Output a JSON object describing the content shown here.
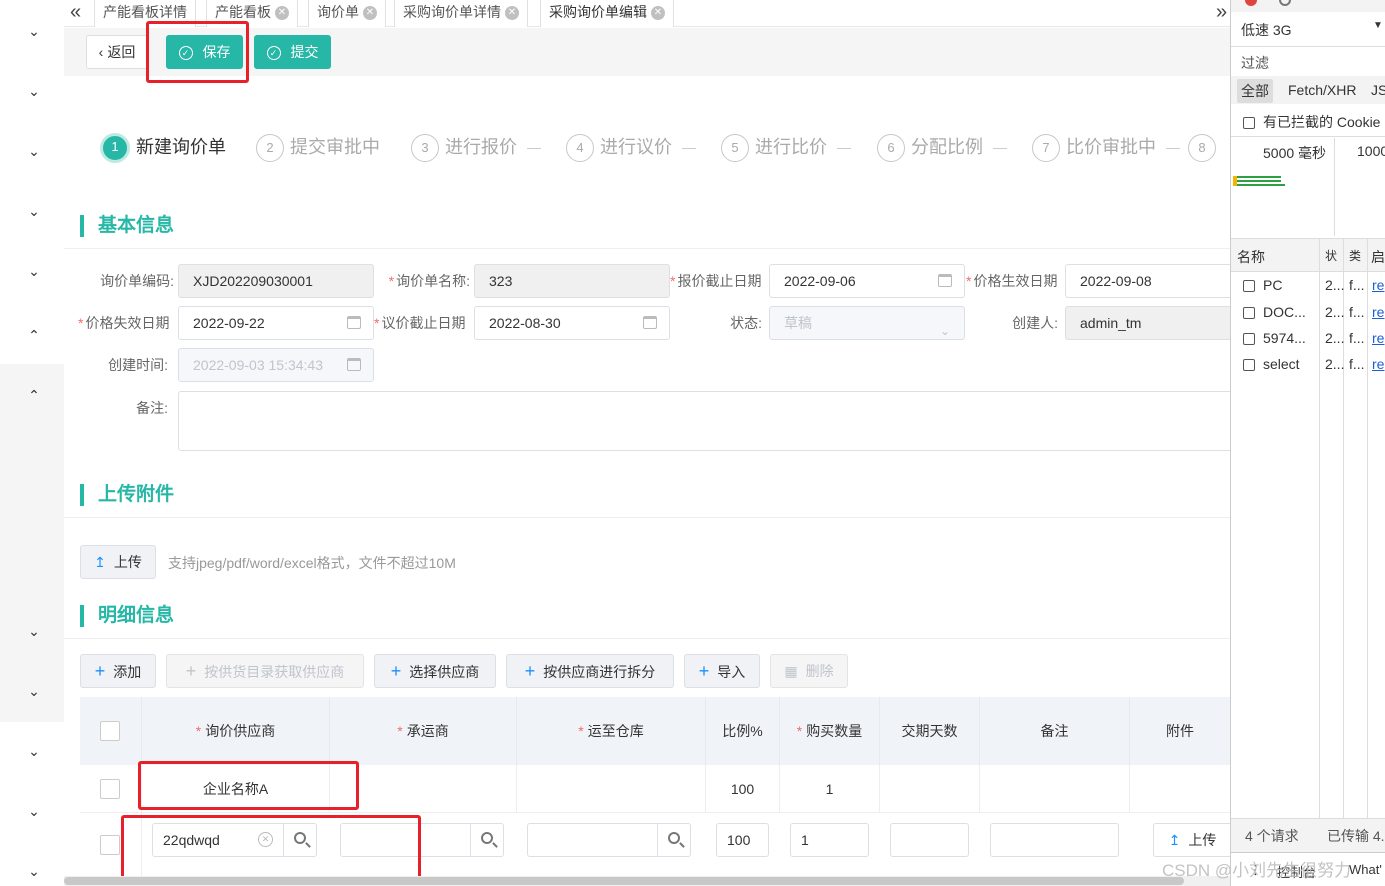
{
  "tabs": {
    "collapse_icon": "double-chevron-left",
    "items": [
      {
        "label": "产能看板详情",
        "closable": false
      },
      {
        "label": "产能看板",
        "closable": true
      },
      {
        "label": "询价单",
        "closable": true
      },
      {
        "label": "采购询价单详情",
        "closable": true
      },
      {
        "label": "采购询价单编辑",
        "closable": true
      }
    ],
    "expand_icon": "double-chevron-right"
  },
  "toolbar": {
    "back_label": "返回",
    "save_label": "保存",
    "submit_label": "提交"
  },
  "steps": [
    {
      "num": "1",
      "label": "新建询价单",
      "active": true
    },
    {
      "num": "2",
      "label": "提交审批中"
    },
    {
      "num": "3",
      "label": "进行报价"
    },
    {
      "num": "4",
      "label": "进行议价"
    },
    {
      "num": "5",
      "label": "进行比价"
    },
    {
      "num": "6",
      "label": "分配比例"
    },
    {
      "num": "7",
      "label": "比价审批中"
    },
    {
      "num": "8",
      "label": ""
    }
  ],
  "basic": {
    "title": "基本信息",
    "code_label": "询价单编码:",
    "code_value": "XJD202209030001",
    "name_label": "询价单名称:",
    "name_value": "323",
    "quote_deadline_label": "报价截止日期",
    "quote_deadline_value": "2022-09-06",
    "price_start_label": "价格生效日期",
    "price_start_value": "2022-09-08",
    "price_end_label": "价格失效日期",
    "price_end_value": "2022-09-22",
    "negotiate_deadline_label": "议价截止日期",
    "negotiate_deadline_value": "2022-08-30",
    "status_label": "状态:",
    "status_value": "草稿",
    "creator_label": "创建人:",
    "creator_value": "admin_tm",
    "created_label": "创建时间:",
    "created_value": "2022-09-03 15:34:43",
    "remark_label": "备注:"
  },
  "upload": {
    "title": "上传附件",
    "button": "上传",
    "hint": "支持jpeg/pdf/word/excel格式，文件不超过10M"
  },
  "detail": {
    "title": "明细信息",
    "actions": {
      "add": "添加",
      "by_catalog": "按供货目录获取供应商",
      "choose": "选择供应商",
      "split": "按供应商进行拆分",
      "import": "导入",
      "delete": "删除"
    },
    "columns": [
      "询价供应商",
      "承运商",
      "运至仓库",
      "比例%",
      "购买数量",
      "交期天数",
      "备注",
      "附件"
    ],
    "row1": {
      "supplier": "企业名称A",
      "ratio": "100",
      "qty": "1"
    },
    "row2": {
      "supplier": "22qdwqd",
      "ratio": "100",
      "qty": "1",
      "upload": "上传"
    }
  },
  "devtools": {
    "throttle": "低速 3G",
    "filter_placeholder": "过滤",
    "filter_types": [
      "全部",
      "Fetch/XHR",
      "JS"
    ],
    "blocked_cookies": "有已拦截的 Cookie",
    "timeline": [
      "5000 毫秒",
      "1000"
    ],
    "name_header": "名称",
    "col2": "状",
    "col3": "类",
    "col4": "启",
    "requests": [
      {
        "name": "PC",
        "c2": "2...",
        "c3": "f...",
        "c4": "re"
      },
      {
        "name": "DOC...",
        "c2": "2...",
        "c3": "f...",
        "c4": "re"
      },
      {
        "name": "5974...",
        "c2": "2...",
        "c3": "f...",
        "c4": "re"
      },
      {
        "name": "select",
        "c2": "2...",
        "c3": "f...",
        "c4": "re"
      }
    ],
    "summary_requests": "4 个请求",
    "summary_transferred": "已传输 4.",
    "console_tab": "控制台",
    "whats_new": "What'"
  },
  "watermark": "CSDN @小刘先生很努力"
}
